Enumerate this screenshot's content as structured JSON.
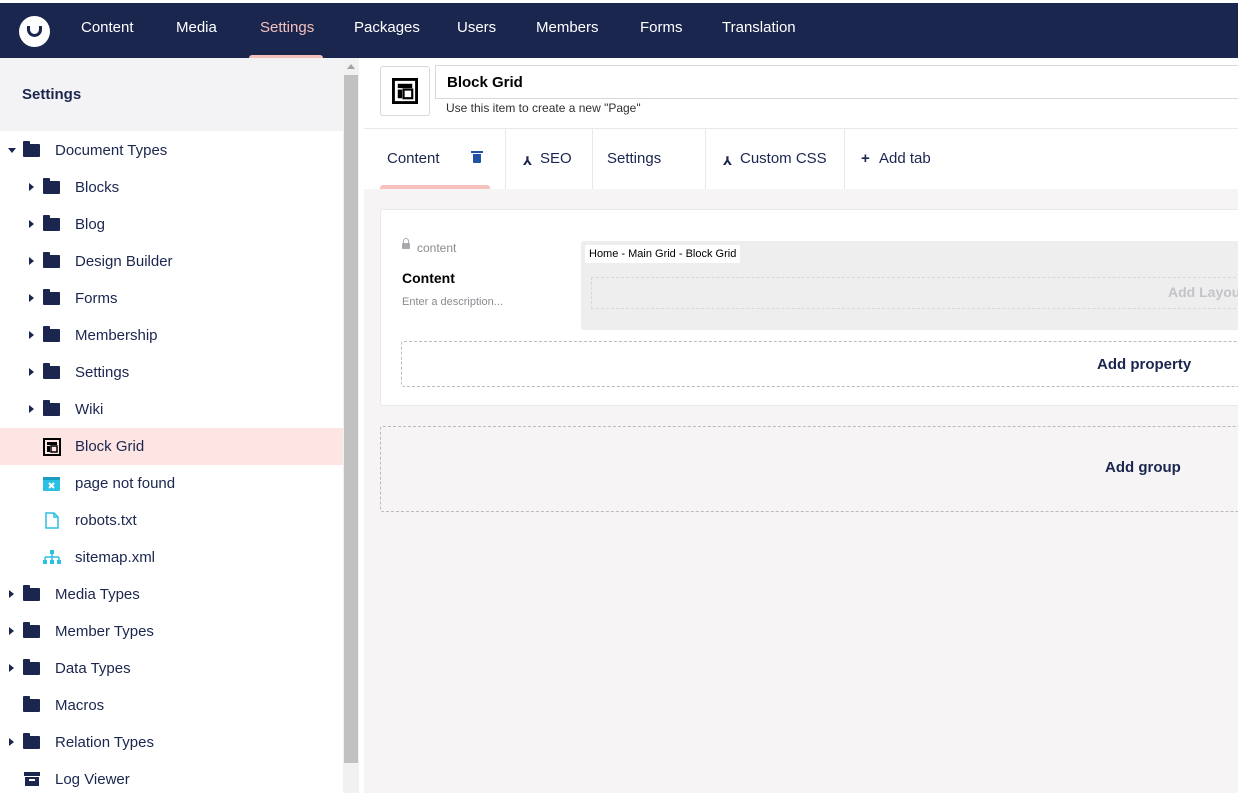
{
  "nav": {
    "items": [
      {
        "label": "Content"
      },
      {
        "label": "Media"
      },
      {
        "label": "Settings"
      },
      {
        "label": "Packages"
      },
      {
        "label": "Users"
      },
      {
        "label": "Members"
      },
      {
        "label": "Forms"
      },
      {
        "label": "Translation"
      }
    ],
    "active": "Settings"
  },
  "sidebar": {
    "title": "Settings",
    "tree": [
      {
        "label": "Document Types",
        "icon": "folder-icon",
        "expanded": true
      },
      {
        "label": "Blocks",
        "icon": "folder-icon"
      },
      {
        "label": "Blog",
        "icon": "folder-icon"
      },
      {
        "label": "Design Builder",
        "icon": "folder-icon"
      },
      {
        "label": "Forms",
        "icon": "folder-icon"
      },
      {
        "label": "Membership",
        "icon": "folder-icon"
      },
      {
        "label": "Settings",
        "icon": "folder-icon"
      },
      {
        "label": "Wiki",
        "icon": "folder-icon"
      },
      {
        "label": "Block Grid",
        "icon": "layout-icon",
        "selected": true
      },
      {
        "label": "page not found",
        "icon": "browser-error-icon"
      },
      {
        "label": "robots.txt",
        "icon": "document-icon"
      },
      {
        "label": "sitemap.xml",
        "icon": "sitemap-icon"
      },
      {
        "label": "Media Types",
        "icon": "folder-icon"
      },
      {
        "label": "Member Types",
        "icon": "folder-icon"
      },
      {
        "label": "Data Types",
        "icon": "folder-icon"
      },
      {
        "label": "Macros",
        "icon": "folder-icon"
      },
      {
        "label": "Relation Types",
        "icon": "folder-icon"
      },
      {
        "label": "Log Viewer",
        "icon": "archive-icon"
      }
    ]
  },
  "editor": {
    "name": "Block Grid",
    "description": "Use this item to create a new \"Page\"",
    "tabs": [
      {
        "label": "Content",
        "active": true
      },
      {
        "label": "SEO",
        "inherited": true
      },
      {
        "label": "Settings"
      },
      {
        "label": "Custom CSS",
        "inherited": true
      },
      {
        "label": "Add tab",
        "add": true
      }
    ],
    "property": {
      "alias": "content",
      "name": "Content",
      "description_placeholder": "Enter a description...",
      "editor_label": "Home - Main Grid - Block Grid",
      "add_layout": "Add Layout"
    },
    "add_property": "Add property",
    "add_group": "Add group"
  },
  "colors": {
    "header_bg": "#1b264f",
    "accent": "#f5c1bc",
    "selected_bg": "#fce5e2",
    "link_blue": "#2152a3"
  }
}
